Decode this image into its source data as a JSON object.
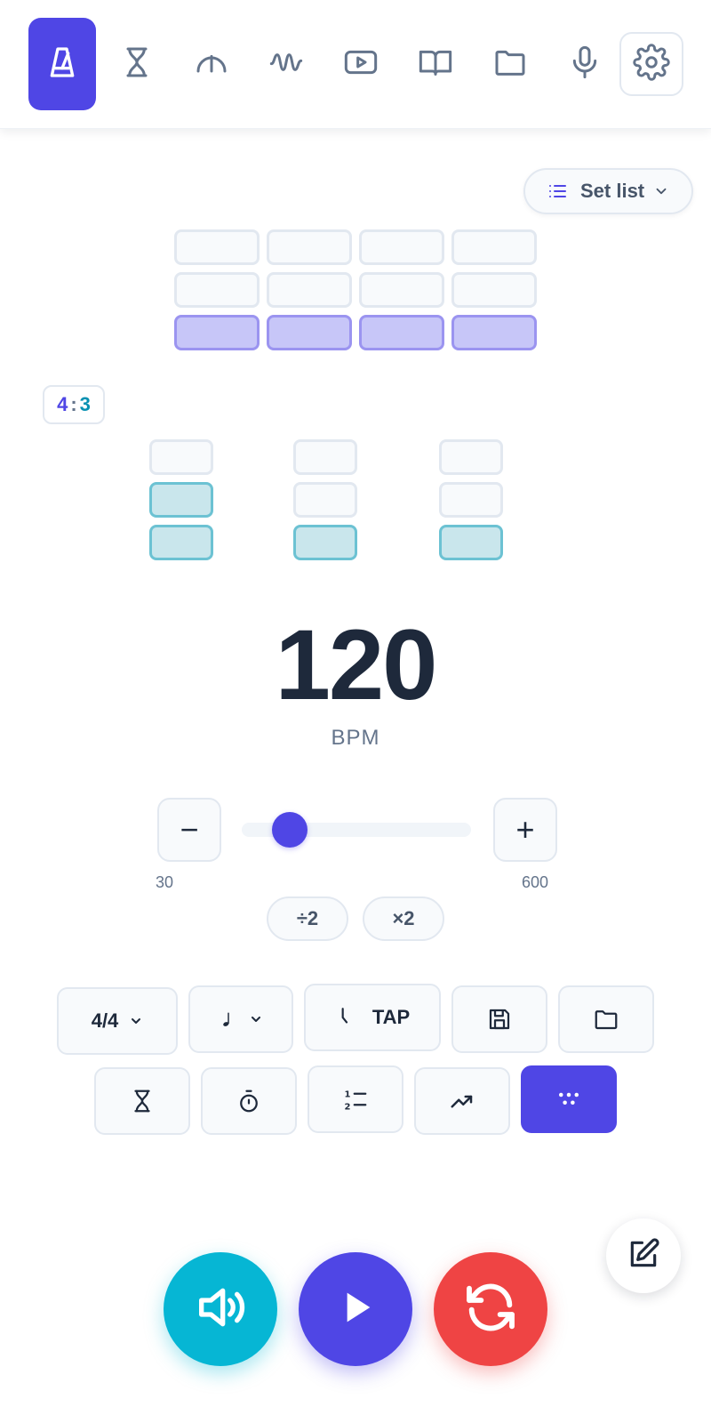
{
  "nav": {
    "items": [
      {
        "icon": "metronome-icon",
        "active": true
      },
      {
        "icon": "hourglass-icon",
        "active": false
      },
      {
        "icon": "gauge-icon",
        "active": false
      },
      {
        "icon": "waveform-icon",
        "active": false
      },
      {
        "icon": "video-icon",
        "active": false
      },
      {
        "icon": "book-icon",
        "active": false
      },
      {
        "icon": "folder-icon",
        "active": false
      },
      {
        "icon": "microphone-icon",
        "active": false
      },
      {
        "icon": "settings-icon",
        "active": false
      }
    ]
  },
  "setlist": {
    "label": "Set list"
  },
  "polyrhythm": {
    "ratio_primary": "4",
    "ratio_separator": ":",
    "ratio_secondary": "3",
    "primary_levels": [
      1,
      1,
      1,
      1
    ],
    "secondary_levels": [
      2,
      1,
      1
    ]
  },
  "tempo": {
    "value": "120",
    "unit": "BPM",
    "min_label": "30",
    "max_label": "600",
    "min": 30,
    "max": 600,
    "current": 120,
    "minus": "−",
    "plus": "+",
    "halve": "÷2",
    "double": "×2"
  },
  "tools": {
    "time_signature": "4/4",
    "note_value_icon": "quarter-note-icon",
    "tap_label": "TAP",
    "row2": [
      "hourglass-icon",
      "stopwatch-icon",
      "numbered-list-icon",
      "trending-up-icon",
      "dots-grid-icon"
    ]
  },
  "colors": {
    "accent": "#4f46e5",
    "teal": "#06b6d4",
    "red": "#ef4444",
    "active_purple_cell": "#c7c6f8",
    "active_teal_cell": "#c9e6ec"
  }
}
